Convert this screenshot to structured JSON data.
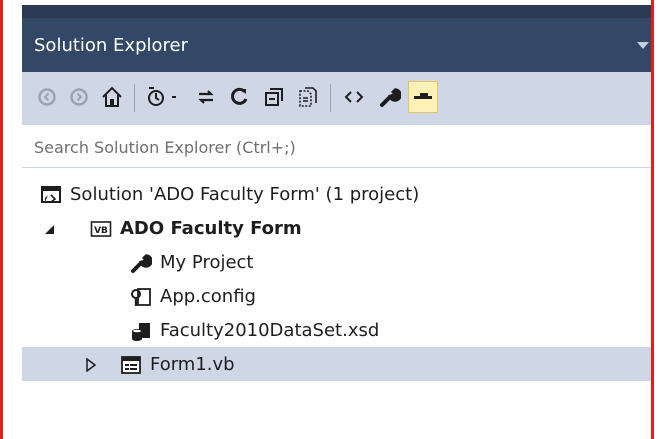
{
  "panel": {
    "title": "Solution Explorer"
  },
  "toolbar": {
    "buttons": [
      {
        "icon": "back-icon"
      },
      {
        "icon": "forward-icon"
      },
      {
        "icon": "home-icon"
      },
      {
        "icon": "pending-changes-filter-icon"
      },
      {
        "icon": "sync-with-active-document-icon"
      },
      {
        "icon": "refresh-icon"
      },
      {
        "icon": "collapse-all-icon"
      },
      {
        "icon": "show-all-files-icon"
      },
      {
        "icon": "view-code-icon"
      },
      {
        "icon": "properties-icon"
      },
      {
        "icon": "auto-hide-pin-icon",
        "active": true
      }
    ]
  },
  "search": {
    "placeholder": "Search Solution Explorer (Ctrl+;)"
  },
  "tree": {
    "items": [
      {
        "label": "Solution 'ADO Faculty Form' (1 project)",
        "icon": "solution-icon"
      },
      {
        "label": "ADO Faculty Form",
        "icon": "vb-project-icon",
        "expanded": true
      },
      {
        "label": "My Project",
        "icon": "wrench-icon"
      },
      {
        "label": "App.config",
        "icon": "config-file-icon"
      },
      {
        "label": "Faculty2010DataSet.xsd",
        "icon": "dataset-icon"
      },
      {
        "label": "Form1.vb",
        "icon": "form-icon",
        "expanded": false,
        "selected": true
      }
    ]
  },
  "colors": {
    "title_bar": "#334766",
    "toolbar": "#cfd6e5",
    "selection": "#cfd6e5",
    "active_button": "#fff1b5",
    "frame": "#e02020"
  }
}
